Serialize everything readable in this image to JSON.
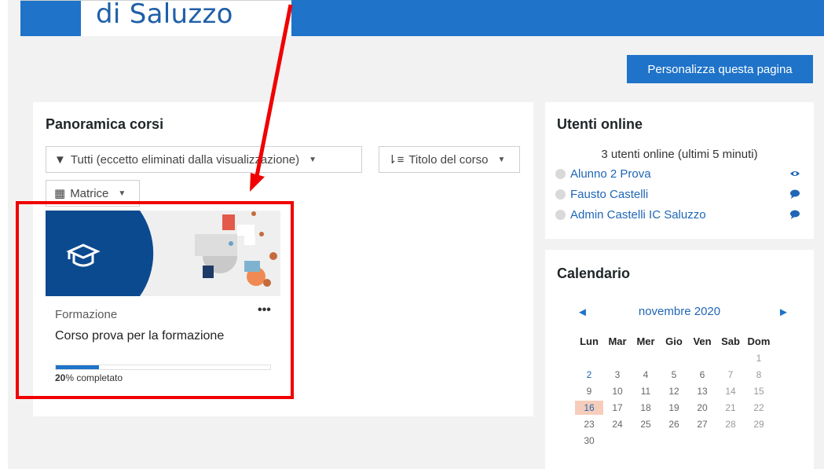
{
  "header": {
    "logo_text": "di Saluzzo",
    "accent": "#1f73c9"
  },
  "customize_button": "Personalizza questa pagina",
  "overview": {
    "title": "Panoramica corsi",
    "filter_label": "Tutti (eccetto eliminati dalla visualizzazione)",
    "sort_label": "Titolo del corso",
    "view_label": "Matrice",
    "course": {
      "category": "Formazione",
      "name": "Corso prova per la formazione",
      "progress_percent": 20,
      "progress_value": "20",
      "progress_suffix": "% completato"
    }
  },
  "online_users": {
    "title": "Utenti online",
    "count_text": "3 utenti online (ultimi 5 minuti)",
    "users": [
      {
        "name": "Alunno 2 Prova",
        "action_icon": "eye-icon"
      },
      {
        "name": "Fausto Castelli",
        "action_icon": "message-icon"
      },
      {
        "name": "Admin Castelli IC Saluzzo",
        "action_icon": "message-icon"
      }
    ]
  },
  "calendar": {
    "title": "Calendario",
    "month": "novembre 2020",
    "prev_symbol": "◄",
    "next_symbol": "►",
    "weekdays": [
      "Lun",
      "Mar",
      "Mer",
      "Gio",
      "Ven",
      "Sab",
      "Dom"
    ],
    "weeks": [
      [
        "",
        "",
        "",
        "",
        "",
        "",
        "1"
      ],
      [
        "2",
        "3",
        "4",
        "5",
        "6",
        "7",
        "8"
      ],
      [
        "9",
        "10",
        "11",
        "12",
        "13",
        "14",
        "15"
      ],
      [
        "16",
        "17",
        "18",
        "19",
        "20",
        "21",
        "22"
      ],
      [
        "23",
        "24",
        "25",
        "26",
        "27",
        "28",
        "29"
      ],
      [
        "30",
        "",
        "",
        "",
        "",
        "",
        ""
      ]
    ],
    "today": "16",
    "highlight_color": "#f6cdbb"
  }
}
